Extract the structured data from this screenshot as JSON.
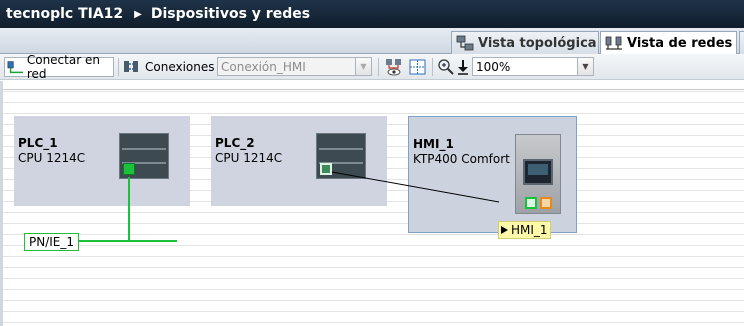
{
  "breadcrumb": {
    "project": "tecnoplc TIA12",
    "separator": "▶",
    "page": "Dispositivos y redes"
  },
  "tabs": [
    {
      "label": "Vista topológica",
      "active": false
    },
    {
      "label": "Vista de redes",
      "active": true
    }
  ],
  "toolbar": {
    "connect_label": "Conectar en red",
    "connections_label": "Conexiones",
    "connection_type": "Conexión_HMI",
    "zoom": "100%"
  },
  "devices": [
    {
      "name": "PLC_1",
      "type": "CPU 1214C"
    },
    {
      "name": "PLC_2",
      "type": "CPU 1214C"
    },
    {
      "name": "HMI_1",
      "type": "KTP400 Comfort"
    }
  ],
  "network": {
    "subnet_label": "PN/IE_1"
  },
  "tooltip": {
    "text": "HMI_1"
  },
  "colors": {
    "network_green": "#19c23a",
    "titlebar": "#1a2b3d",
    "device_bg": "#d0d4e1",
    "tooltip_bg": "#fdf9a8"
  }
}
